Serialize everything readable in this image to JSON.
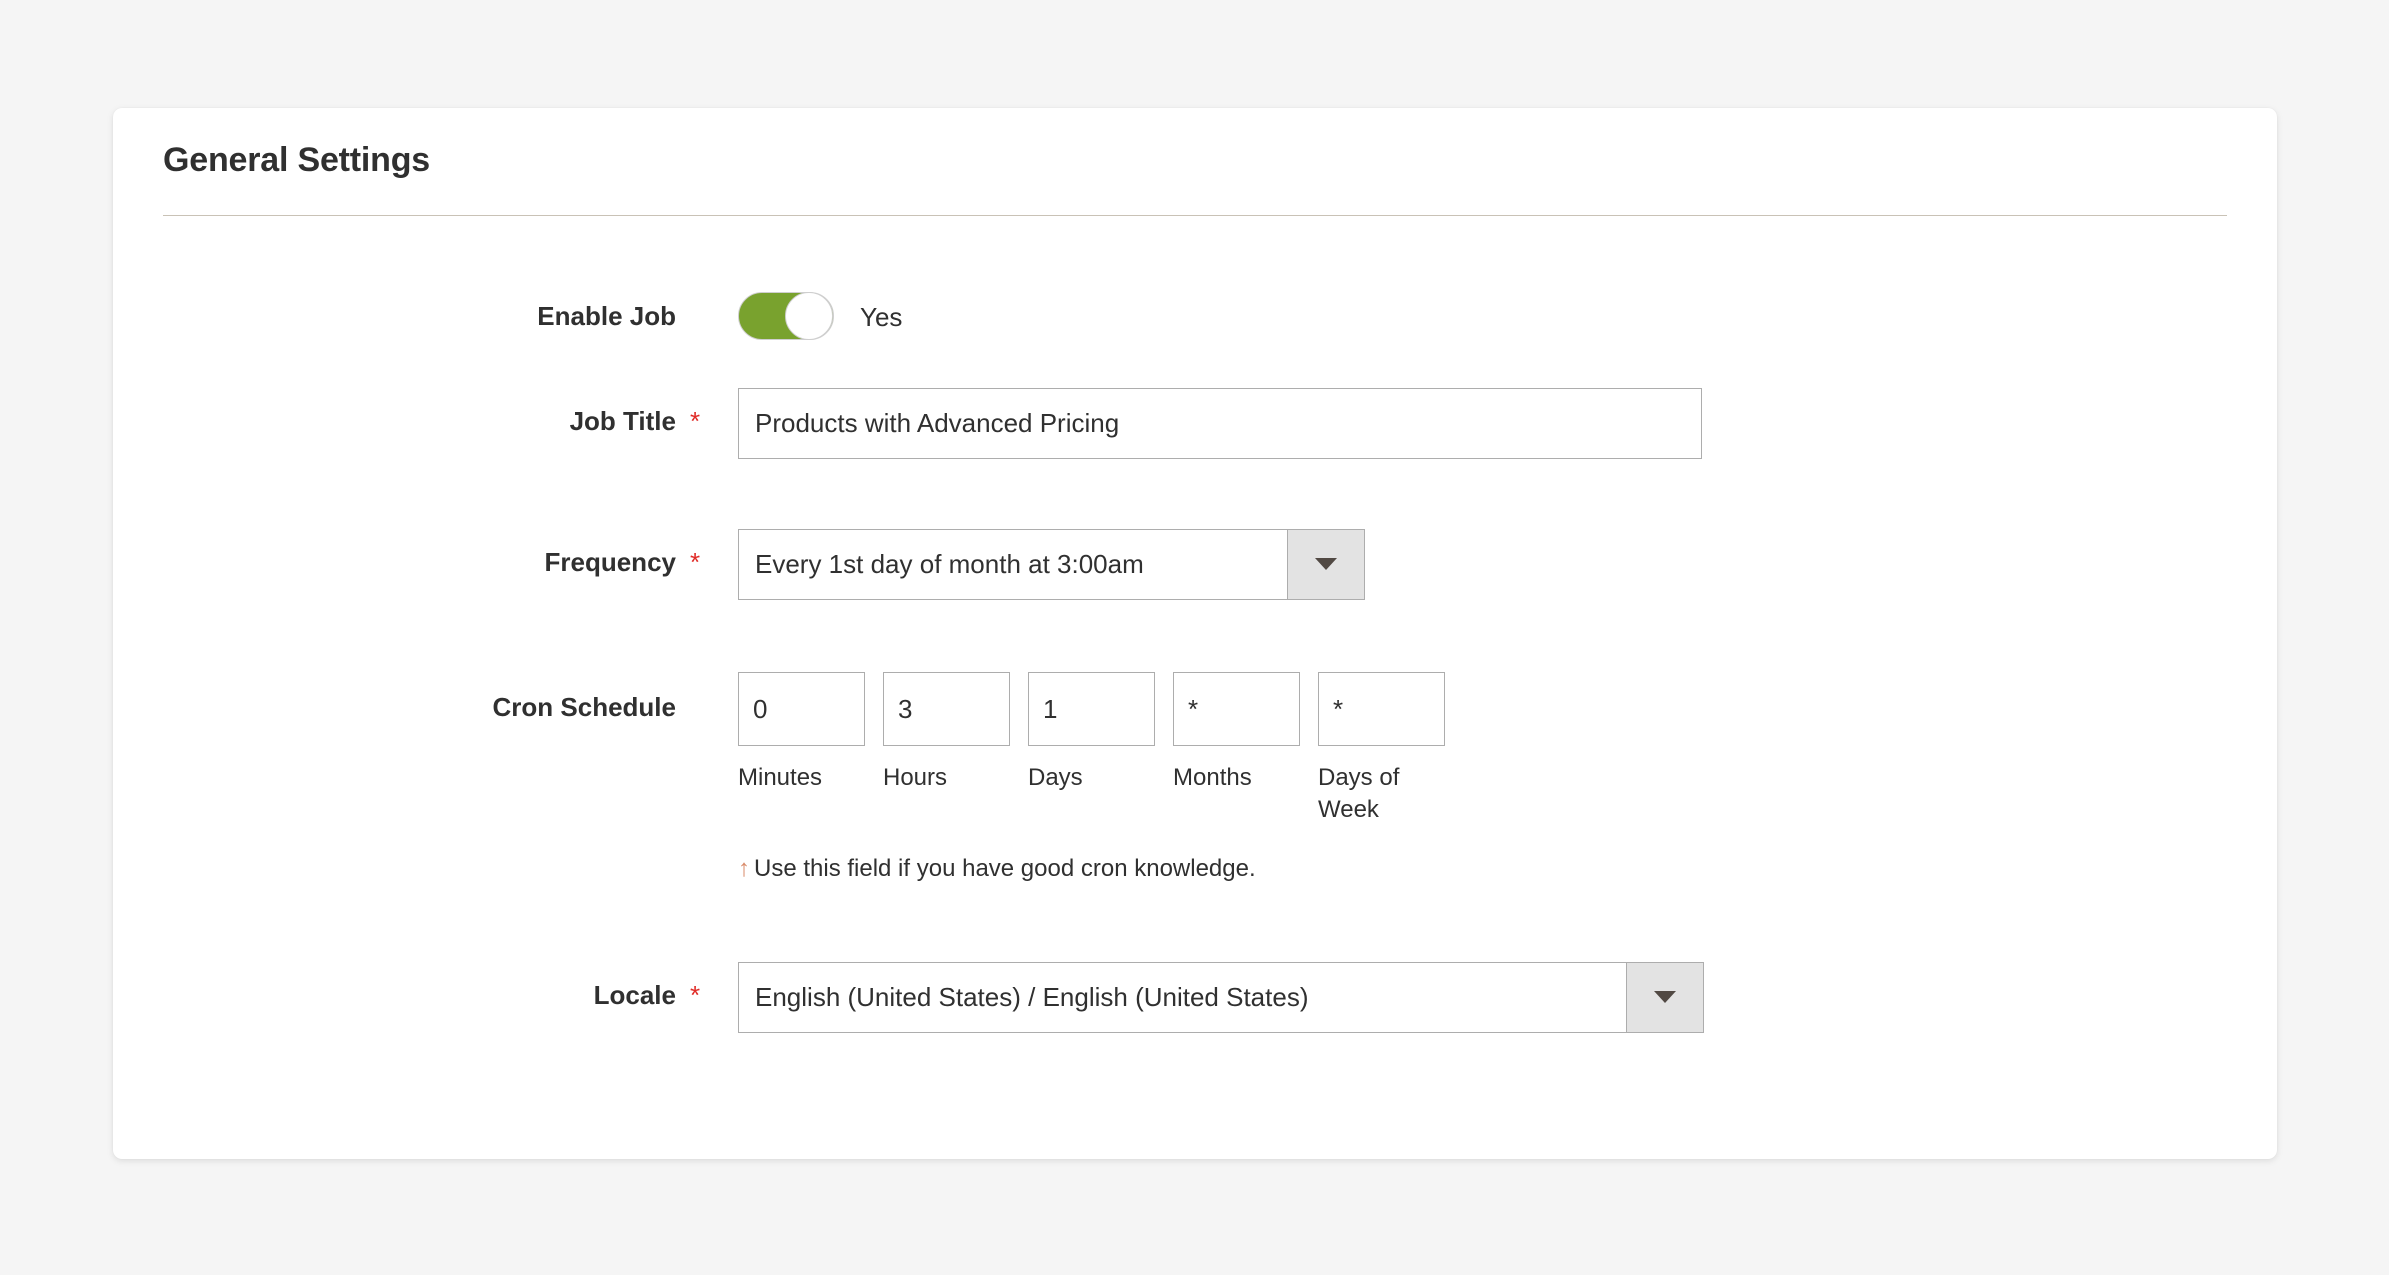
{
  "card": {
    "section_title": "General Settings"
  },
  "form": {
    "enable_job": {
      "label": "Enable Job",
      "required": false,
      "toggle_state_label": "Yes",
      "toggle_on": true,
      "on_color": "#79a22e"
    },
    "job_title": {
      "label": "Job Title",
      "required_marker": "*",
      "value": "Products with Advanced Pricing",
      "placeholder": ""
    },
    "frequency": {
      "label": "Frequency",
      "required_marker": "*",
      "selected": "Every 1st day of month at 3:00am"
    },
    "cron_schedule": {
      "label": "Cron Schedule",
      "required_marker": "",
      "fields": [
        {
          "value": "0",
          "label": "Minutes"
        },
        {
          "value": "3",
          "label": "Hours"
        },
        {
          "value": "1",
          "label": "Days"
        },
        {
          "value": "*",
          "label": "Months"
        },
        {
          "value": "*",
          "label": "Days of Week"
        }
      ],
      "note_arrow": "↑",
      "note": "Use this field if you have good cron knowledge."
    },
    "locale": {
      "label": "Locale",
      "required_marker": "*",
      "selected": "English (United States) / English (United States)"
    }
  },
  "colors": {
    "page_background": "#f5f5f5",
    "card_background": "#ffffff",
    "title_text": "#303030",
    "title_rule": "#c9c2b6",
    "required_asterisk": "#e02b27",
    "input_border": "#adadad",
    "select_button": "#e3e3e3",
    "toggle_on": "#79a22e"
  }
}
